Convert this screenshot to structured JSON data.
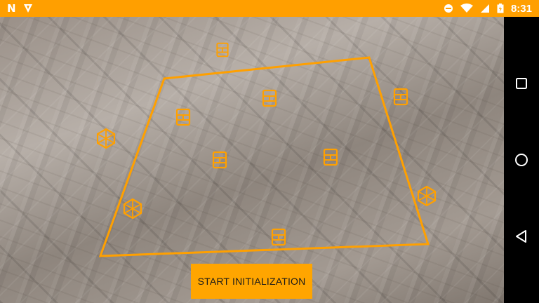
{
  "status_bar": {
    "notifications": [
      "N",
      "download"
    ],
    "icons": [
      "dnd-icon",
      "wifi-icon",
      "signal-icon",
      "battery-icon"
    ],
    "time": "8:31",
    "background": "#ff9f00"
  },
  "ar_overlay": {
    "plane_color": "#ffa000",
    "markers": [
      "cube",
      "cube",
      "cube",
      "cube",
      "cube",
      "cube",
      "cube",
      "cube",
      "cube",
      "cube",
      "cube"
    ]
  },
  "actions": {
    "start_label": "START INITIALIZATION",
    "button_color": "#ffa500"
  },
  "nav_bar": {
    "buttons": [
      "recents-icon",
      "home-icon",
      "back-icon"
    ]
  }
}
